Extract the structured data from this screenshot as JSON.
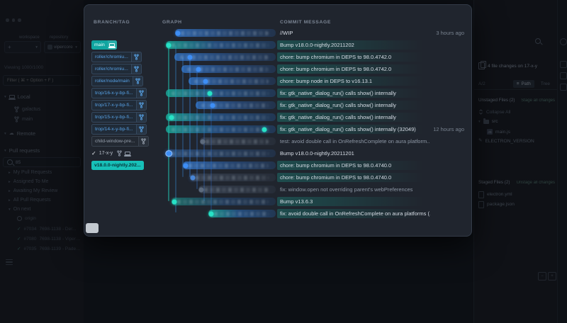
{
  "colors": {
    "accent_teal": "#1fbfae",
    "accent_blue": "#3e8ef5",
    "panel_bg": "#20252e",
    "app_bg": "#15181e"
  },
  "icons": {
    "check": "✓",
    "chevron_right": "▸",
    "chevron_down": "▾",
    "plus": "+",
    "kebab": "⋯",
    "list": "≡",
    "cloud": "☁",
    "pencil": "✎",
    "js_badge": "JS",
    "minus": "−",
    "plus2": "+"
  },
  "sidebar": {
    "workspace_label": "workspace",
    "repository_label": "repository",
    "repo_name": "vipercore",
    "viewing": "Viewing 1000/1000",
    "filter_placeholder": "Filter ( ⌘ + Option + F )",
    "local_header": "Local",
    "branches": [
      {
        "name": "galactus"
      },
      {
        "name": "main"
      }
    ],
    "remote_header": "Remote",
    "pull_requests_header": "Pull requests",
    "pr_search_value": "85",
    "pr_filters": [
      "My Pull Requests",
      "Assigned To Me",
      "Awaiting My Review",
      "All Pull Requests"
    ],
    "pr_group": "On next",
    "remote_name": "origin",
    "prs": [
      {
        "id": "#7034",
        "title": "7698-1138 - Der..."
      },
      {
        "id": "#7080",
        "title": "7698-1138 - ViperCor..."
      },
      {
        "id": "#7035",
        "title": "7698-1139 - Padeecee..."
      }
    ]
  },
  "modal": {
    "header": {
      "branch_tag": "BRANCH/TAG",
      "graph": "GRAPH",
      "commit_message": "COMMIT MESSAGE"
    },
    "rows": [
      {
        "message": "//WIP",
        "time": "3 hours ago"
      },
      {
        "pill": "main",
        "message": "Bump v18.0.0-nightly.20211202"
      },
      {
        "pill": "roller/chromiu...",
        "message": "chore: bump chromium in DEPS to 98.0.4742.0"
      },
      {
        "pill": "roller/chromiu...",
        "message": "chore: bump chromium in DEPS to 98.0.4742.0"
      },
      {
        "pill": "roller/node/main",
        "message": "chore: bump node in DEPS to v16.13.1"
      },
      {
        "pill": "trop/16-x-y-bp-fi...",
        "message": "fix: gtk_native_dialog_run() calls show() internally"
      },
      {
        "pill": "trop/17-x-y-bp-fi...",
        "message": "fix: gtk_native_dialog_run() calls show() internally"
      },
      {
        "pill": "trop/15-x-y-bp-fi...",
        "message": "fix: gtk_native_dialog_run() calls show() internally"
      },
      {
        "pill": "trop/14-x-y-bp-fi...",
        "message": "fix: gtk_native_dialog_run() calls show() internally (32049)",
        "time": "12 hours ago"
      },
      {
        "pill": "child-window-pre...",
        "message": "test: avoid double call in OnRefreshComplete on aura platform..."
      },
      {
        "pill": "17-x-y",
        "check": "✓",
        "message": "Bump v18.0.0-nightly.20211201"
      },
      {
        "pill": "v18.0.0-nightly.202...",
        "message": "chore: bump chromium in DEPS to 98.0.4740.0"
      },
      {
        "message": "chore: bump chromium in DEPS to 98.0.4740.0"
      },
      {
        "message": "fix: window.open not overriding parent's webPreferences"
      },
      {
        "message": "Bump v13.6.3"
      },
      {
        "message": "fix: avoid double call in OnRefreshComplete on aura platforms (..."
      }
    ]
  },
  "right_panel": {
    "file_changes": "4 file changes on 17-x-y",
    "ahead_behind": "A/2",
    "tab_path": "Path",
    "tab_tree": "Tree",
    "unstaged_header": "Unstaged Files (2)",
    "stage_all": "Stage all changes",
    "collapse_all": "Collapse All",
    "folder_src": "src",
    "file_main_js": "main.js",
    "file_electron_version": "ELECTRON_VERSION",
    "staged_header": "Staged Files (2)",
    "unstage_all": "Unstage all changes",
    "staged_files": [
      {
        "name": "electron.yml"
      },
      {
        "name": "package.json"
      }
    ]
  }
}
